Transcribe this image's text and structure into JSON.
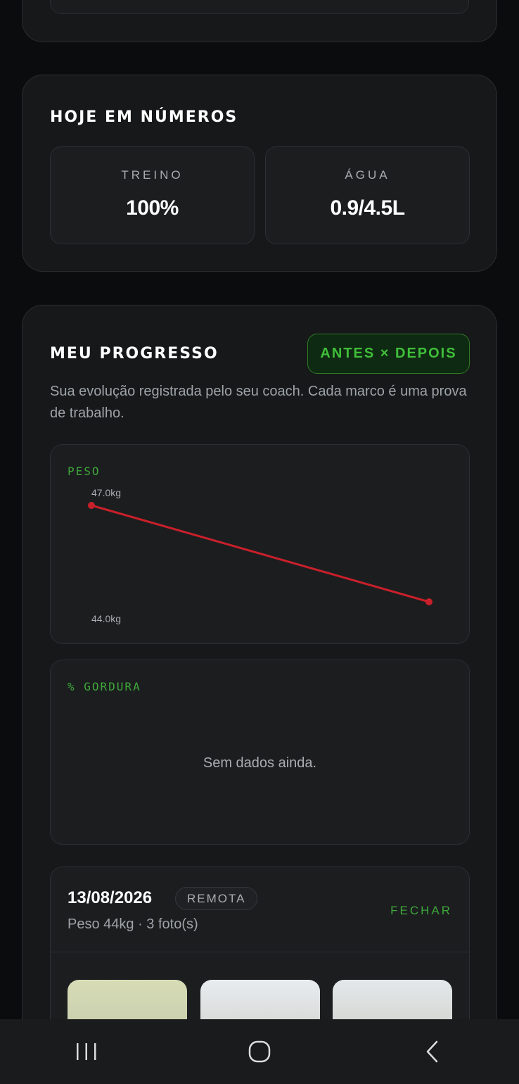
{
  "today": {
    "title": "HOJE EM NÚMEROS",
    "stats": [
      {
        "label": "TREINO",
        "value": "100%"
      },
      {
        "label": "ÁGUA",
        "value": "0.9/4.5L"
      }
    ]
  },
  "progress": {
    "title": "MEU PROGRESSO",
    "compare_button": "ANTES × DEPOIS",
    "description": "Sua evolução registrada pelo seu coach. Cada marco é uma prova de trabalho.",
    "weight_chart_label": "PESO",
    "fat_chart_label": "% GORDURA",
    "fat_empty": "Sem dados ainda."
  },
  "chart_data": {
    "type": "line",
    "title": "PESO",
    "series": [
      {
        "values": [
          47.0,
          44.0
        ],
        "color": "#c8202a"
      }
    ],
    "max_label": "47.0kg",
    "min_label": "44.0kg",
    "ylim": [
      44.0,
      47.0
    ]
  },
  "session": {
    "date": "13/08/2026",
    "badge": "REMOTA",
    "summary": "Peso 44kg · 3 foto(s)",
    "close_label": "FECHAR",
    "photo_count": 3
  },
  "navbar": {
    "items": [
      "recent-apps-icon",
      "home-icon",
      "back-icon"
    ]
  }
}
